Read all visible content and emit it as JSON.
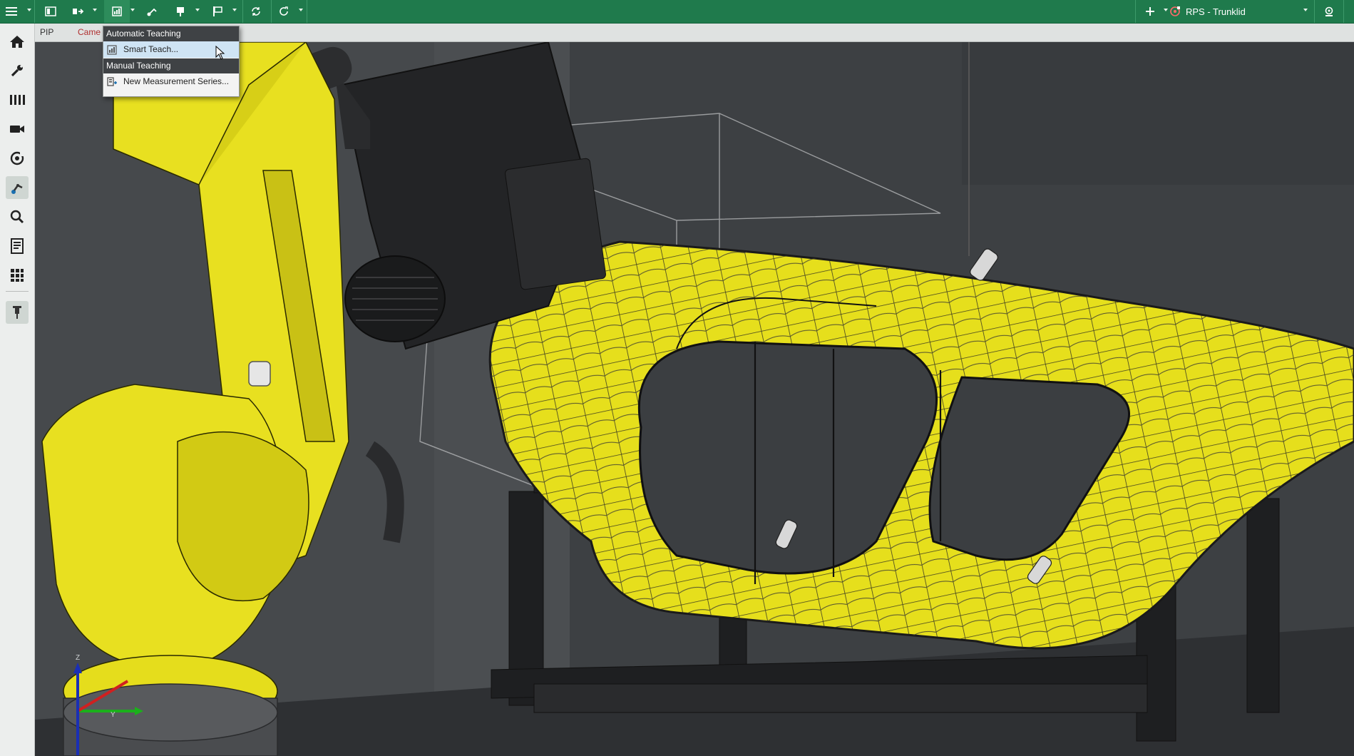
{
  "toolbar": {
    "buttons": [
      {
        "icon": "hamburger-menu-icon"
      },
      {
        "icon": "layout-panels-icon"
      },
      {
        "icon": "move-robot-icon"
      },
      {
        "icon": "teach-icon"
      },
      {
        "icon": "path-tool-icon"
      },
      {
        "icon": "gauge-icon"
      },
      {
        "icon": "flag-icon"
      },
      {
        "icon": "sync-icon"
      },
      {
        "icon": "redo-icon"
      }
    ],
    "add_icon": "plus-icon",
    "project_icon": "rps-target-icon",
    "project_name": "RPS - Trunklid",
    "settings_icon": "settings-icon",
    "accent": "#1f7a4c"
  },
  "sidebar": {
    "items": [
      {
        "icon": "home-icon"
      },
      {
        "icon": "wrench-icon"
      },
      {
        "icon": "columns-icon"
      },
      {
        "icon": "video-camera-icon"
      },
      {
        "icon": "rotate-view-icon"
      },
      {
        "icon": "robot-arm-icon"
      },
      {
        "icon": "magnifier-icon"
      },
      {
        "icon": "report-icon"
      },
      {
        "icon": "grid-icon"
      },
      {
        "icon": "pin-icon"
      }
    ]
  },
  "tabs": [
    {
      "label": "PIP"
    },
    {
      "label": "Came"
    }
  ],
  "menu": {
    "section1_header": "Automatic Teaching",
    "smart_teach_label": "Smart Teach...",
    "section2_header": "Manual Teaching",
    "new_series_label": "New Measurement Series..."
  },
  "viewport": {
    "axis_labels": {
      "z": "Z",
      "y": "Y"
    },
    "part_color": "#e8e020",
    "background": "#3b3e41"
  }
}
